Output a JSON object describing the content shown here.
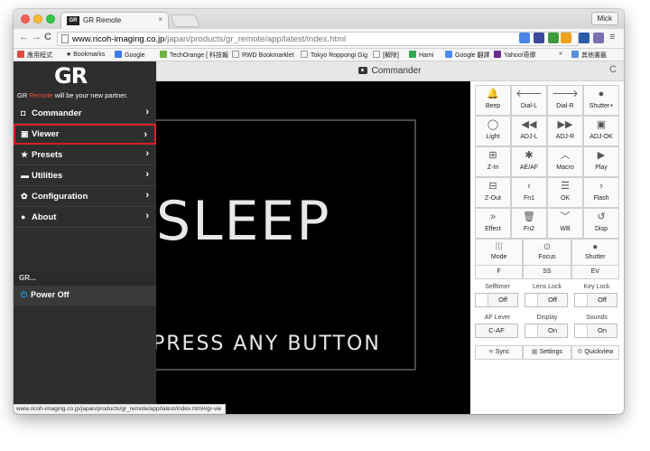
{
  "browser": {
    "tab_title": "GR Remote",
    "tab_favicon": "GR",
    "tab_close": "×",
    "user": "Mick",
    "url_host": "www.ricoh-imaging.co.jp",
    "url_path": "/japan/products/gr_remote/app/latest/index.html",
    "back_icon": "←",
    "forward_icon": "→",
    "reload_icon": "C",
    "menu_icon": "≡",
    "star_icon": "☆",
    "status_url": "www.ricoh-imaging.co.jp/japan/products/gr_remote/app/latest/index.html#gr-vie"
  },
  "bookmarks": {
    "items": [
      "應用程式",
      "Bookmarks",
      "Google",
      "TechOrange [ 科技報",
      "RWD Bookmarklet",
      "Tokyo Roppongi Gig",
      "[解除]",
      "Hami",
      "Google 翻譯",
      "Yahoo!奇摩"
    ],
    "overflow": "»",
    "other": "其他書籤"
  },
  "app": {
    "logo": "GR",
    "tagline_pre": "GR ",
    "tagline_red": "Remote",
    "tagline_post": " will be your new partner.",
    "header_title": "Commander",
    "refresh_icon": "C",
    "sleep_text": "SLEEP",
    "press_text": "PRESS ANY BUTTON"
  },
  "menu": {
    "items": [
      {
        "icon": "camera-icon",
        "glyph": "◘",
        "label": "Commander"
      },
      {
        "icon": "viewer-icon",
        "glyph": "▣",
        "label": "Viewer"
      },
      {
        "icon": "star-icon",
        "glyph": "★",
        "label": "Presets"
      },
      {
        "icon": "toolbox-icon",
        "glyph": "▬",
        "label": "Utilities"
      },
      {
        "icon": "gear-icon",
        "glyph": "✿",
        "label": "Configuration"
      },
      {
        "icon": "info-icon",
        "glyph": "●",
        "label": "About"
      }
    ],
    "chevron": "›",
    "section": "GR...",
    "power": "Power Off",
    "power_glyph": "⏻"
  },
  "controls": {
    "grid": [
      {
        "glyph": "🔔",
        "label": "Beep"
      },
      {
        "glyph": "🡐",
        "label": "Dial-L"
      },
      {
        "glyph": "🡒",
        "label": "Dial-R"
      },
      {
        "glyph": "●",
        "label": "Shutter+"
      },
      {
        "glyph": "◯",
        "label": "Light"
      },
      {
        "glyph": "◀◀",
        "label": "ADJ-L"
      },
      {
        "glyph": "▶▶",
        "label": "ADJ-R"
      },
      {
        "glyph": "▣",
        "label": "ADJ-OK"
      },
      {
        "glyph": "⊞",
        "label": "Z-In"
      },
      {
        "glyph": "✱",
        "label": "AE/AF"
      },
      {
        "glyph": "︿",
        "label": "Macro"
      },
      {
        "glyph": "▶",
        "label": "Play"
      },
      {
        "glyph": "⊟",
        "label": "Z-Out"
      },
      {
        "glyph": "‹",
        "label": "Fn1"
      },
      {
        "glyph": "☰",
        "label": "OK"
      },
      {
        "glyph": "›",
        "label": "Flash"
      },
      {
        "glyph": "»",
        "label": "Effect"
      },
      {
        "glyph": "🗑",
        "label": "Fn2"
      },
      {
        "glyph": "﹀",
        "label": "WB"
      },
      {
        "glyph": "↺",
        "label": "Disp"
      }
    ],
    "wide": [
      {
        "glyph": "⁞⁞⁞",
        "label": "Mode"
      },
      {
        "glyph": "⊙",
        "label": "Focus"
      },
      {
        "glyph": "●",
        "label": "Shutter"
      }
    ],
    "flat": [
      "F",
      "SS",
      "EV"
    ],
    "toggles": [
      {
        "label": "Selftimer",
        "value": "Off"
      },
      {
        "label": "Lens Lock",
        "value": "Off"
      },
      {
        "label": "Key Lock",
        "value": "Off"
      },
      {
        "label": "AF Lever",
        "value": "C-AF"
      },
      {
        "label": "Display",
        "value": "On"
      },
      {
        "label": "Sounds",
        "value": "On"
      }
    ],
    "bottom": [
      {
        "glyph": "≋",
        "label": "Sync"
      },
      {
        "glyph": "▦",
        "label": "Settings"
      },
      {
        "glyph": "⚙",
        "label": "Quickview"
      }
    ]
  },
  "selected_menu_index": 1,
  "accent_red": "#d81e26",
  "power_blue": "#1aa4e0"
}
